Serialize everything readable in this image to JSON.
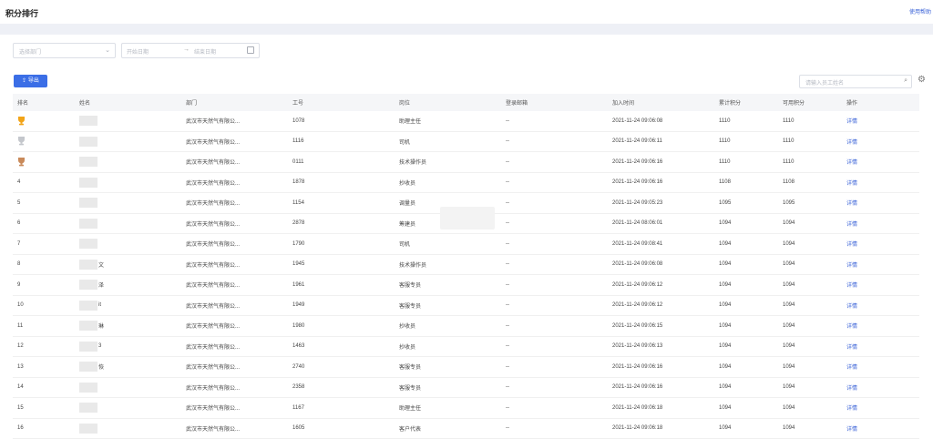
{
  "header": {
    "title": "积分排行",
    "help_link": "使用帮助"
  },
  "filters": {
    "department_placeholder": "选择部门",
    "start_placeholder": "开始日期",
    "range_separator": "→",
    "end_placeholder": "结束日期"
  },
  "toolbar": {
    "export_label": "导出",
    "search_placeholder": "请输入员工姓名"
  },
  "table": {
    "columns": [
      "排名",
      "姓名",
      "部门",
      "工号",
      "岗位",
      "登录邮箱",
      "加入时间",
      "累计积分",
      "可用积分",
      "操作"
    ],
    "rows": [
      {
        "rank": "1",
        "name": "",
        "dept": "武汉市天然气有限公...",
        "id": "1078",
        "post": "助理主任",
        "email": "--",
        "joined": "2021-11-24 09:06:08",
        "total": "1110",
        "avail": "1110",
        "op": "详情"
      },
      {
        "rank": "2",
        "name": "",
        "dept": "武汉市天然气有限公...",
        "id": "1116",
        "post": "司机",
        "email": "--",
        "joined": "2021-11-24 09:06:11",
        "total": "1110",
        "avail": "1110",
        "op": "详情"
      },
      {
        "rank": "3",
        "name": "",
        "dept": "武汉市天然气有限公...",
        "id": "0111",
        "post": "技术操作员",
        "email": "--",
        "joined": "2021-11-24 09:06:16",
        "total": "1110",
        "avail": "1110",
        "op": "详情"
      },
      {
        "rank": "4",
        "name": "",
        "dept": "武汉市天然气有限公...",
        "id": "1878",
        "post": "抄收员",
        "email": "--",
        "joined": "2021-11-24 09:06:16",
        "total": "1108",
        "avail": "1108",
        "op": "详情"
      },
      {
        "rank": "5",
        "name": "",
        "dept": "武汉市天然气有限公...",
        "id": "1154",
        "post": "调量员",
        "email": "--",
        "joined": "2021-11-24 09:05:23",
        "total": "1095",
        "avail": "1095",
        "op": "详情"
      },
      {
        "rank": "6",
        "name": "",
        "dept": "武汉市天然气有限公...",
        "id": "2878",
        "post": "筹建员",
        "email": "--",
        "joined": "2021-11-24 08:06:01",
        "total": "1094",
        "avail": "1094",
        "op": "详情"
      },
      {
        "rank": "7",
        "name": "",
        "dept": "武汉市天然气有限公...",
        "id": "1790",
        "post": "司机",
        "email": "--",
        "joined": "2021-11-24 09:08:41",
        "total": "1094",
        "avail": "1094",
        "op": "详情"
      },
      {
        "rank": "8",
        "name": "文",
        "dept": "武汉市天然气有限公...",
        "id": "1945",
        "post": "技术操作员",
        "email": "--",
        "joined": "2021-11-24 09:06:08",
        "total": "1094",
        "avail": "1094",
        "op": "详情"
      },
      {
        "rank": "9",
        "name": "泽",
        "dept": "武汉市天然气有限公...",
        "id": "1961",
        "post": "客服专员",
        "email": "--",
        "joined": "2021-11-24 09:06:12",
        "total": "1094",
        "avail": "1094",
        "op": "详情"
      },
      {
        "rank": "10",
        "name": "it",
        "dept": "武汉市天然气有限公...",
        "id": "1949",
        "post": "客服专员",
        "email": "--",
        "joined": "2021-11-24 09:06:12",
        "total": "1094",
        "avail": "1094",
        "op": "详情"
      },
      {
        "rank": "11",
        "name": "琳",
        "dept": "武汉市天然气有限公...",
        "id": "1980",
        "post": "抄收员",
        "email": "--",
        "joined": "2021-11-24 09:06:15",
        "total": "1094",
        "avail": "1094",
        "op": "详情"
      },
      {
        "rank": "12",
        "name": "3",
        "dept": "武汉市天然气有限公...",
        "id": "1463",
        "post": "抄收员",
        "email": "--",
        "joined": "2021-11-24 09:06:13",
        "total": "1094",
        "avail": "1094",
        "op": "详情"
      },
      {
        "rank": "13",
        "name": "恢",
        "dept": "武汉市天然气有限公...",
        "id": "2740",
        "post": "客服专员",
        "email": "--",
        "joined": "2021-11-24 09:06:16",
        "total": "1094",
        "avail": "1094",
        "op": "详情"
      },
      {
        "rank": "14",
        "name": "",
        "dept": "武汉市天然气有限公...",
        "id": "2358",
        "post": "客服专员",
        "email": "--",
        "joined": "2021-11-24 09:06:16",
        "total": "1094",
        "avail": "1094",
        "op": "详情"
      },
      {
        "rank": "15",
        "name": "",
        "dept": "武汉市天然气有限公...",
        "id": "1167",
        "post": "助理主任",
        "email": "--",
        "joined": "2021-11-24 09:06:18",
        "total": "1094",
        "avail": "1094",
        "op": "详情"
      },
      {
        "rank": "16",
        "name": "",
        "dept": "武汉市天然气有限公...",
        "id": "1605",
        "post": "客户代表",
        "email": "--",
        "joined": "2021-11-24 09:06:18",
        "total": "1094",
        "avail": "1094",
        "op": "详情"
      }
    ]
  },
  "icons": {
    "rank1": "gold-trophy-icon",
    "rank2": "silver-trophy-icon",
    "rank3": "bronze-trophy-icon"
  },
  "colors": {
    "accent": "#3b6ee6",
    "gold": "#f2a418",
    "silver": "#c4c7cc",
    "bronze": "#c98a5a"
  }
}
